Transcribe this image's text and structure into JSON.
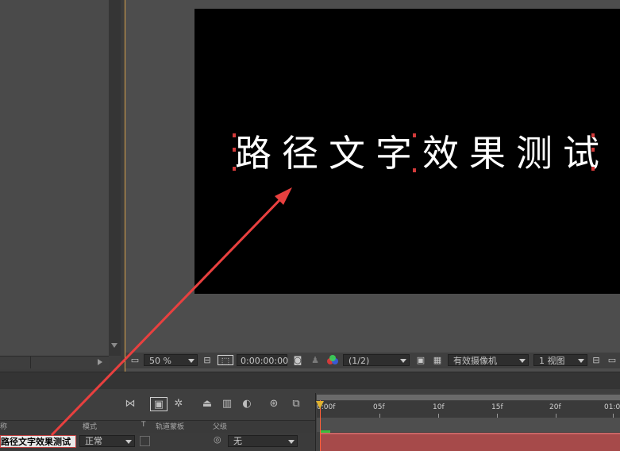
{
  "composition": {
    "text": "路径文字效果测试"
  },
  "viewer_toolbar": {
    "zoom": "50 %",
    "timecode": "0:00:00:00",
    "resolution": "(1/2)",
    "camera": "有效摄像机",
    "views": "1 视图"
  },
  "timeline": {
    "col_mode": "模式",
    "col_t": "T",
    "col_trkmat": "轨道蒙板",
    "col_parent": "父级",
    "col_name_fragment": "称",
    "layer": {
      "name": "路径文字效果测试",
      "mode": "正常",
      "parent": "无"
    },
    "ruler_labels": [
      "0:00f",
      "05f",
      "10f",
      "15f",
      "20f",
      "01:0"
    ]
  },
  "colors": {
    "panel_border_active": "#d9a24a",
    "annotation_arrow": "#e8403f",
    "layer_bar": "#a64a4a",
    "playhead": "#e0b230"
  },
  "icons": [
    "toggle-switches-icon",
    "draft-3d-icon",
    "frame-blending-icon",
    "motion-blur-icon",
    "graph-editor-icon",
    "snapshot-icon",
    "channel-icon",
    "region-icon",
    "transparency-grid-icon"
  ]
}
